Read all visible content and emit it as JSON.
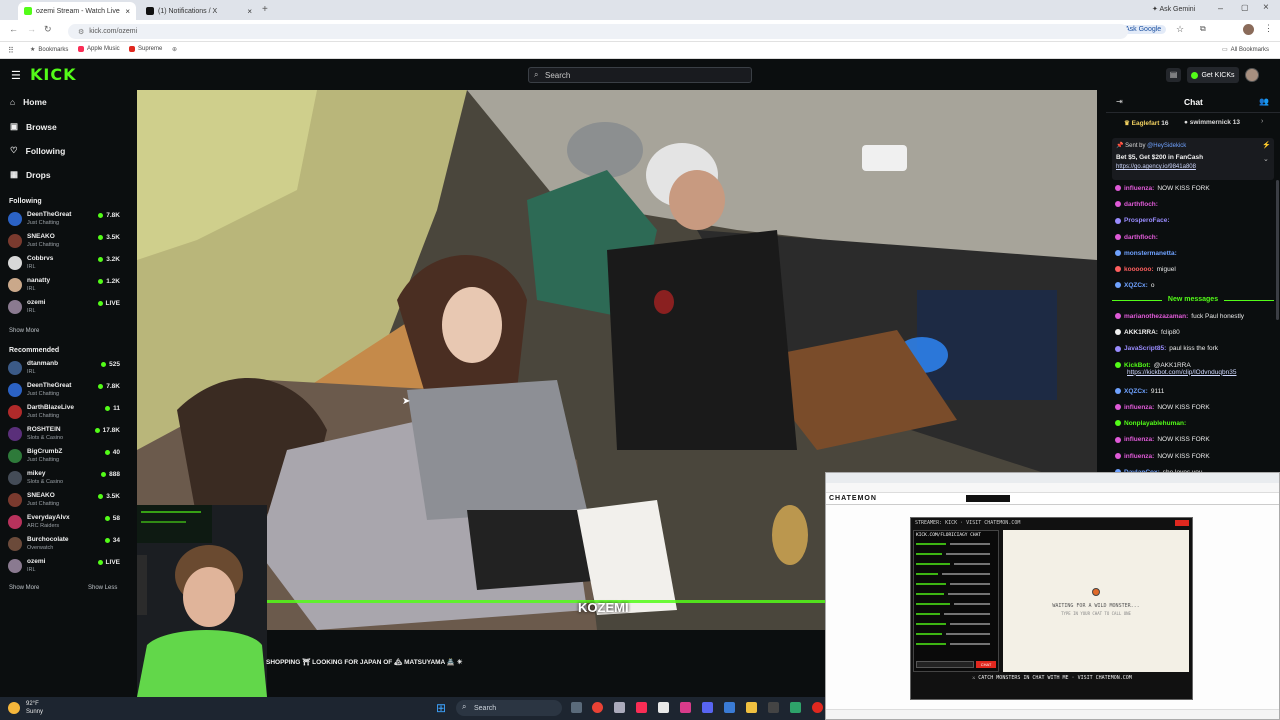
{
  "browser": {
    "tabs": [
      {
        "label": "ozemi Stream - Watch Live",
        "active": true
      },
      {
        "label": "(1) Notifications / X",
        "active": false
      }
    ],
    "ask_gemini": "Ask Gemini",
    "url": "kick.com/ozemi",
    "ask_google": "Ask Google",
    "bookmarks": [
      "Bookmarks",
      "Apple Music",
      "Supreme"
    ],
    "all_bookmarks": "All Bookmarks"
  },
  "header": {
    "logo": "KICK",
    "search_placeholder": "Search",
    "get_kicks": "Get KICKs"
  },
  "sidebar": {
    "nav": [
      {
        "label": "Home",
        "icon": "home-icon"
      },
      {
        "label": "Browse",
        "icon": "browse-icon"
      },
      {
        "label": "Following",
        "icon": "heart-icon"
      },
      {
        "label": "Drops",
        "icon": "drops-icon"
      }
    ],
    "following_title": "Following",
    "following": [
      {
        "name": "DeenTheGreat",
        "category": "Just Chatting",
        "viewers": "7.8K",
        "color": "#2b62c4"
      },
      {
        "name": "SNEAKO",
        "category": "Just Chatting",
        "viewers": "3.5K",
        "color": "#7a3a2e"
      },
      {
        "name": "Cobbrvs",
        "category": "IRL",
        "viewers": "3.2K",
        "color": "#d8d8d8"
      },
      {
        "name": "nanatty",
        "category": "IRL",
        "viewers": "1.2K",
        "color": "#caa88a"
      },
      {
        "name": "ozemi",
        "category": "IRL",
        "viewers": "LIVE",
        "color": "#8a7a90"
      }
    ],
    "show_more": "Show More",
    "recommended_title": "Recommended",
    "recommended": [
      {
        "name": "dtanmanb",
        "category": "IRL",
        "viewers": "525",
        "color": "#3b5a87"
      },
      {
        "name": "DeenTheGreat",
        "category": "Just Chatting",
        "viewers": "7.8K",
        "color": "#2b62c4"
      },
      {
        "name": "DarthBlazeLive",
        "category": "Just Chatting",
        "viewers": "11",
        "color": "#b02a2a"
      },
      {
        "name": "ROSHTEIN",
        "category": "Slots & Casino",
        "viewers": "17.8K",
        "color": "#5a2f7a"
      },
      {
        "name": "BigCrumbZ",
        "category": "Just Chatting",
        "viewers": "40",
        "color": "#2e7a3a"
      },
      {
        "name": "mikey",
        "category": "Slots & Casino",
        "viewers": "888",
        "color": "#444c57"
      },
      {
        "name": "SNEAKO",
        "category": "Just Chatting",
        "viewers": "3.5K",
        "color": "#7a3a2e"
      },
      {
        "name": "EverydayAlvx",
        "category": "ARC Raiders",
        "viewers": "58",
        "color": "#b8325c"
      },
      {
        "name": "Burchocolate",
        "category": "Overwatch",
        "viewers": "34",
        "color": "#6b4a3a"
      },
      {
        "name": "ozemi",
        "category": "IRL",
        "viewers": "LIVE",
        "color": "#8a7a90"
      }
    ],
    "show_more_2": "Show More",
    "show_less": "Show Less"
  },
  "video": {
    "watermark": "KOZEMI",
    "ticker": "SHOPPING ⛩ LOOKING FOR JAPAN OF 🏔 MATSUYAMA 🏯 ☀"
  },
  "chat": {
    "title": "Chat",
    "top_gifters": [
      {
        "name": "Eaglefart",
        "count": "16"
      },
      {
        "name": "swimmernick",
        "count": "13"
      }
    ],
    "pinned": {
      "sent_by": "Sent by",
      "sender": "@HeySidekick",
      "text": "Bet $5, Get $200 in FanCash",
      "link": "https://go.agency.io/9841a808"
    },
    "messages_before": [
      {
        "user": "influenza:",
        "text": "NOW KISS FORK",
        "color": "#e05ad8"
      },
      {
        "user": "darthfloch:",
        "text": "",
        "color": "#e05ad8"
      },
      {
        "user": "ProsperoFace:",
        "text": "",
        "color": "#9a8cff"
      },
      {
        "user": "darthfloch:",
        "text": "",
        "color": "#e05ad8"
      },
      {
        "user": "monstermanetta:",
        "text": "",
        "color": "#6fa2ff"
      },
      {
        "user": "koooooo:",
        "text": "miguel",
        "color": "#ff5f5f"
      },
      {
        "user": "XQZCx:",
        "text": "o",
        "color": "#6fa2ff"
      }
    ],
    "new_messages": "New messages",
    "messages_after": [
      {
        "user": "marianothezazaman:",
        "text": "fuck Paul honestly",
        "color": "#e05ad8"
      },
      {
        "user": "AKK1RRA:",
        "text": "fclip80",
        "color": "#f0f0f0"
      },
      {
        "user": "JavaScript85:",
        "text": "paul kiss the fork",
        "color": "#9a8cff"
      },
      {
        "user": "KickBot:",
        "text": "@AKK1RRA",
        "color": "#53fc18",
        "link": "https://kickbot.com/clip/lOdvnduqbn35"
      },
      {
        "user": "XQZCx:",
        "text": "9111",
        "color": "#6fa2ff"
      },
      {
        "user": "influenza:",
        "text": "NOW KISS FORK",
        "color": "#e05ad8"
      },
      {
        "user": "Nonplayablehuman:",
        "text": "",
        "color": "#53fc18"
      },
      {
        "user": "influenza:",
        "text": "NOW KISS FORK",
        "color": "#e05ad8"
      },
      {
        "user": "influenza:",
        "text": "NOW KISS FORK",
        "color": "#e05ad8"
      },
      {
        "user": "DaylanCox:",
        "text": "she loves you",
        "color": "#6fa2ff"
      }
    ]
  },
  "overlay": {
    "site": "CHATEMON",
    "panel_header": "STREAMER: KICK · VISIT CHATEMON.COM",
    "chat_header": "KICK.COM/FLORICIAGY CHAT",
    "waiting_title": "WAITING FOR A WILD MONSTER...",
    "waiting_sub": "TYPE IN YOUR CHAT TO CALL ONE",
    "footer": "⚔ CATCH MONSTERS IN CHAT WITH ME · VISIT CHATEMON.COM",
    "send": "CHAT"
  },
  "taskbar": {
    "temp": "92°F",
    "condition": "Sunny",
    "search": "Search"
  },
  "colors": {
    "accent": "#53fc18",
    "bg": "#0b0e0f"
  }
}
